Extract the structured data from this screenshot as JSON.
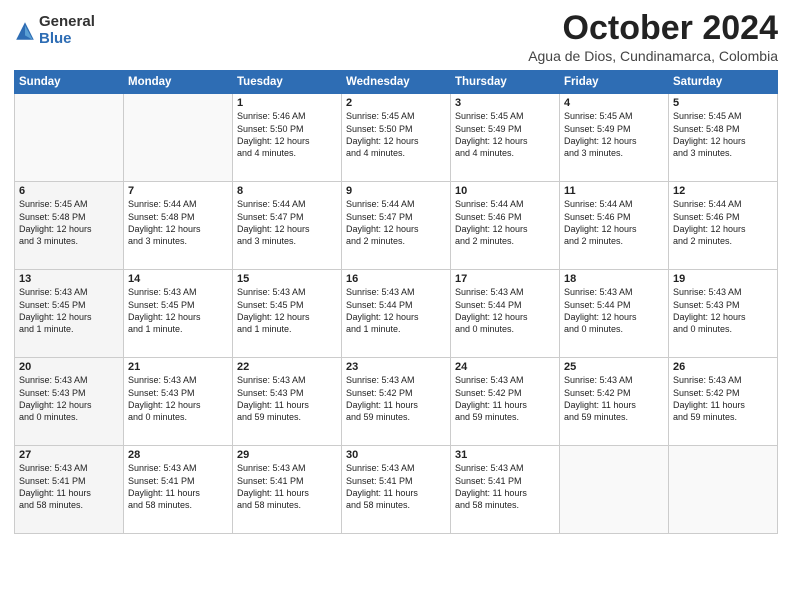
{
  "logo": {
    "general": "General",
    "blue": "Blue"
  },
  "header": {
    "month": "October 2024",
    "location": "Agua de Dios, Cundinamarca, Colombia"
  },
  "days_of_week": [
    "Sunday",
    "Monday",
    "Tuesday",
    "Wednesday",
    "Thursday",
    "Friday",
    "Saturday"
  ],
  "weeks": [
    [
      {
        "day": "",
        "info": ""
      },
      {
        "day": "",
        "info": ""
      },
      {
        "day": "1",
        "info": "Sunrise: 5:46 AM\nSunset: 5:50 PM\nDaylight: 12 hours\nand 4 minutes."
      },
      {
        "day": "2",
        "info": "Sunrise: 5:45 AM\nSunset: 5:50 PM\nDaylight: 12 hours\nand 4 minutes."
      },
      {
        "day": "3",
        "info": "Sunrise: 5:45 AM\nSunset: 5:49 PM\nDaylight: 12 hours\nand 4 minutes."
      },
      {
        "day": "4",
        "info": "Sunrise: 5:45 AM\nSunset: 5:49 PM\nDaylight: 12 hours\nand 3 minutes."
      },
      {
        "day": "5",
        "info": "Sunrise: 5:45 AM\nSunset: 5:48 PM\nDaylight: 12 hours\nand 3 minutes."
      }
    ],
    [
      {
        "day": "6",
        "info": "Sunrise: 5:45 AM\nSunset: 5:48 PM\nDaylight: 12 hours\nand 3 minutes."
      },
      {
        "day": "7",
        "info": "Sunrise: 5:44 AM\nSunset: 5:48 PM\nDaylight: 12 hours\nand 3 minutes."
      },
      {
        "day": "8",
        "info": "Sunrise: 5:44 AM\nSunset: 5:47 PM\nDaylight: 12 hours\nand 3 minutes."
      },
      {
        "day": "9",
        "info": "Sunrise: 5:44 AM\nSunset: 5:47 PM\nDaylight: 12 hours\nand 2 minutes."
      },
      {
        "day": "10",
        "info": "Sunrise: 5:44 AM\nSunset: 5:46 PM\nDaylight: 12 hours\nand 2 minutes."
      },
      {
        "day": "11",
        "info": "Sunrise: 5:44 AM\nSunset: 5:46 PM\nDaylight: 12 hours\nand 2 minutes."
      },
      {
        "day": "12",
        "info": "Sunrise: 5:44 AM\nSunset: 5:46 PM\nDaylight: 12 hours\nand 2 minutes."
      }
    ],
    [
      {
        "day": "13",
        "info": "Sunrise: 5:43 AM\nSunset: 5:45 PM\nDaylight: 12 hours\nand 1 minute."
      },
      {
        "day": "14",
        "info": "Sunrise: 5:43 AM\nSunset: 5:45 PM\nDaylight: 12 hours\nand 1 minute."
      },
      {
        "day": "15",
        "info": "Sunrise: 5:43 AM\nSunset: 5:45 PM\nDaylight: 12 hours\nand 1 minute."
      },
      {
        "day": "16",
        "info": "Sunrise: 5:43 AM\nSunset: 5:44 PM\nDaylight: 12 hours\nand 1 minute."
      },
      {
        "day": "17",
        "info": "Sunrise: 5:43 AM\nSunset: 5:44 PM\nDaylight: 12 hours\nand 0 minutes."
      },
      {
        "day": "18",
        "info": "Sunrise: 5:43 AM\nSunset: 5:44 PM\nDaylight: 12 hours\nand 0 minutes."
      },
      {
        "day": "19",
        "info": "Sunrise: 5:43 AM\nSunset: 5:43 PM\nDaylight: 12 hours\nand 0 minutes."
      }
    ],
    [
      {
        "day": "20",
        "info": "Sunrise: 5:43 AM\nSunset: 5:43 PM\nDaylight: 12 hours\nand 0 minutes."
      },
      {
        "day": "21",
        "info": "Sunrise: 5:43 AM\nSunset: 5:43 PM\nDaylight: 12 hours\nand 0 minutes."
      },
      {
        "day": "22",
        "info": "Sunrise: 5:43 AM\nSunset: 5:43 PM\nDaylight: 11 hours\nand 59 minutes."
      },
      {
        "day": "23",
        "info": "Sunrise: 5:43 AM\nSunset: 5:42 PM\nDaylight: 11 hours\nand 59 minutes."
      },
      {
        "day": "24",
        "info": "Sunrise: 5:43 AM\nSunset: 5:42 PM\nDaylight: 11 hours\nand 59 minutes."
      },
      {
        "day": "25",
        "info": "Sunrise: 5:43 AM\nSunset: 5:42 PM\nDaylight: 11 hours\nand 59 minutes."
      },
      {
        "day": "26",
        "info": "Sunrise: 5:43 AM\nSunset: 5:42 PM\nDaylight: 11 hours\nand 59 minutes."
      }
    ],
    [
      {
        "day": "27",
        "info": "Sunrise: 5:43 AM\nSunset: 5:41 PM\nDaylight: 11 hours\nand 58 minutes."
      },
      {
        "day": "28",
        "info": "Sunrise: 5:43 AM\nSunset: 5:41 PM\nDaylight: 11 hours\nand 58 minutes."
      },
      {
        "day": "29",
        "info": "Sunrise: 5:43 AM\nSunset: 5:41 PM\nDaylight: 11 hours\nand 58 minutes."
      },
      {
        "day": "30",
        "info": "Sunrise: 5:43 AM\nSunset: 5:41 PM\nDaylight: 11 hours\nand 58 minutes."
      },
      {
        "day": "31",
        "info": "Sunrise: 5:43 AM\nSunset: 5:41 PM\nDaylight: 11 hours\nand 58 minutes."
      },
      {
        "day": "",
        "info": ""
      },
      {
        "day": "",
        "info": ""
      }
    ]
  ]
}
